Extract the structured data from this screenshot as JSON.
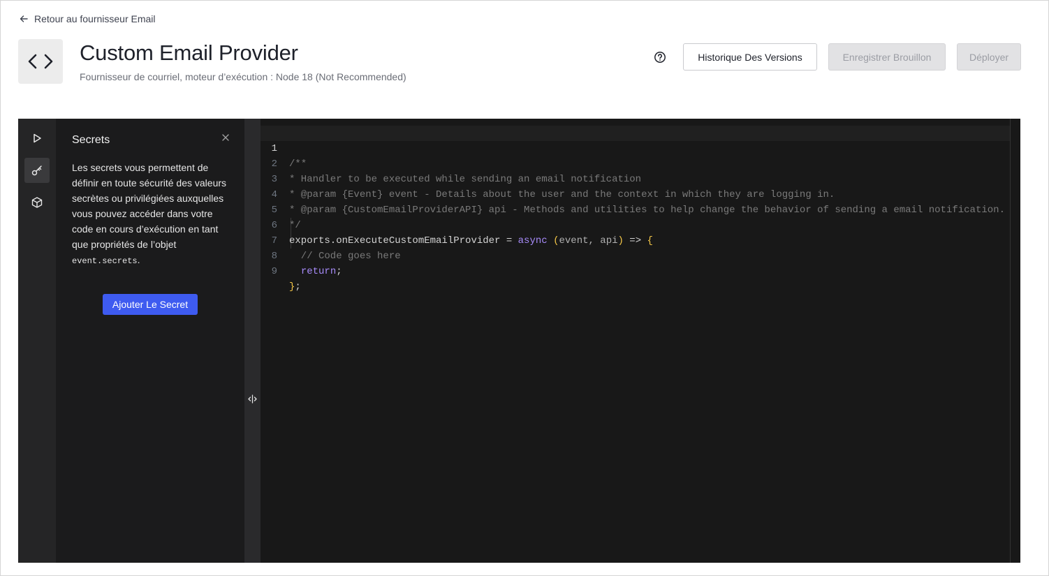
{
  "nav": {
    "back_label": "Retour au fournisseur Email"
  },
  "header": {
    "title": "Custom Email Provider",
    "subtitle": "Fournisseur de courriel, moteur d’exécution : Node 18 (Not Recommended)",
    "icon": "code-brackets-icon"
  },
  "actions": {
    "help_icon": "question-circle-icon",
    "history_label": "Historique Des Versions",
    "draft_label": "Enregistrer Brouillon",
    "deploy_label": "Déployer"
  },
  "rail": {
    "items": [
      {
        "icon": "play-icon",
        "active": false
      },
      {
        "icon": "key-icon",
        "active": true
      },
      {
        "icon": "package-icon",
        "active": false
      }
    ]
  },
  "secrets_panel": {
    "title": "Secrets",
    "description": "Les secrets vous permettent de définir en toute sécurité des valeurs secrètes ou privilégiées auxquelles vous pouvez accéder dans votre code en cours d’exécution en tant que propriétés de l’objet",
    "code_ref": "event.secrets",
    "code_suffix": ".",
    "add_button_label": "Ajouter Le Secret"
  },
  "editor": {
    "active_line": 1,
    "lines": [
      {
        "num": "1",
        "text": "/**"
      },
      {
        "num": "2",
        "text": "* Handler to be executed while sending an email notification"
      },
      {
        "num": "3",
        "text": "* @param {Event} event - Details about the user and the context in which they are logging in."
      },
      {
        "num": "4",
        "text": "* @param {CustomEmailProviderAPI} api - Methods and utilities to help change the behavior of sending a email notification."
      },
      {
        "num": "5",
        "text": "*/"
      },
      {
        "num": "6",
        "text_a": "exports.onExecuteCustomEmailProvider = ",
        "kw": "async",
        "paren_open": " (",
        "params": "event, api",
        "paren_close": ")",
        "arrow": " => ",
        "brace": "{"
      },
      {
        "num": "7",
        "text": "  // Code goes here"
      },
      {
        "num": "8",
        "indent": "  ",
        "kw": "return",
        "rest": ";"
      },
      {
        "num": "9",
        "brace": "}",
        "rest": ";"
      }
    ]
  },
  "colors": {
    "accent": "#3e5bf0",
    "editor_bg": "#181818",
    "keyword": "#a78bfa",
    "brace": "#f7c948",
    "comment": "#7a7a7a"
  }
}
